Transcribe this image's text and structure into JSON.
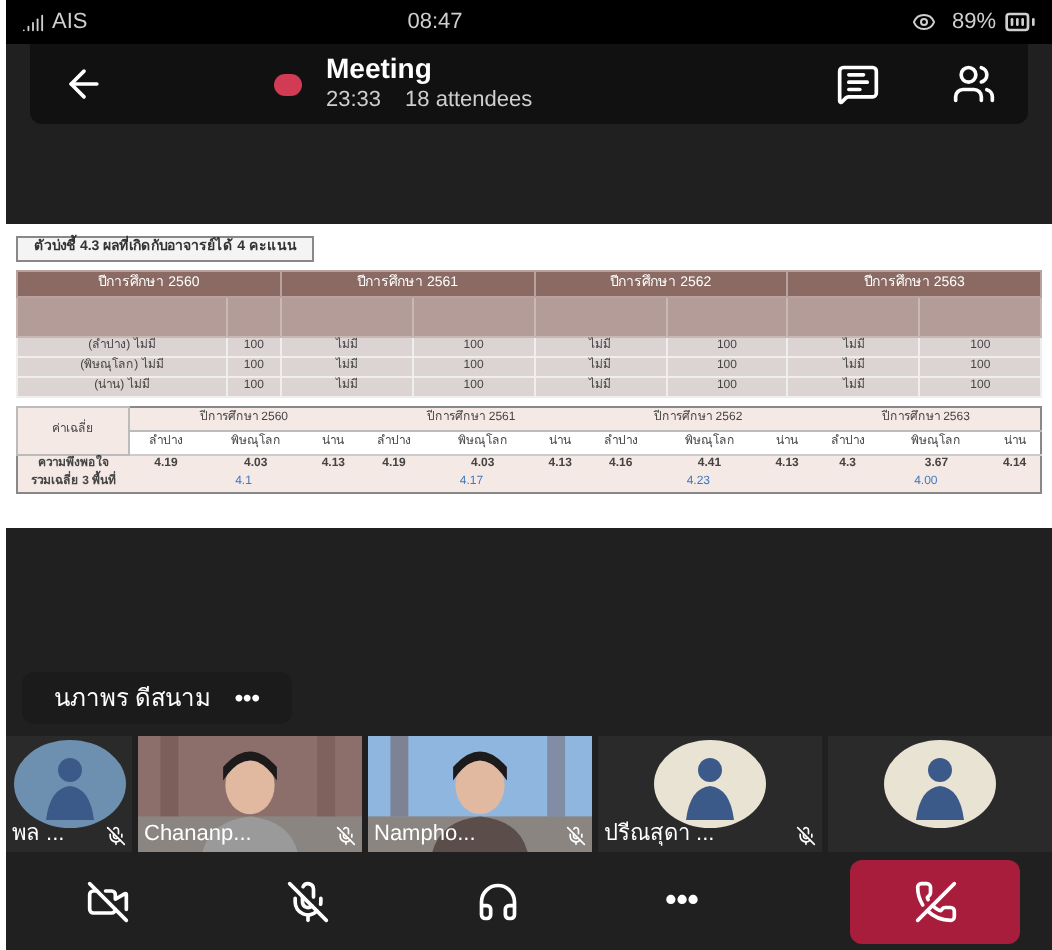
{
  "status_bar": {
    "carrier": "AIS",
    "time": "08:47",
    "battery": "89%"
  },
  "meeting": {
    "title": "Meeting",
    "duration": "23:33",
    "attendees": "18 attendees",
    "recording": true
  },
  "shared_screen": {
    "caption": "ตัวบ่งชี้ 4.3 ผลที่เกิดกับอาจารย์ได้ 4 คะแนน",
    "table_1": {
      "years": [
        "ปีการศึกษา 2560",
        "ปีการศึกษา 2561",
        "ปีการศึกษา 2562",
        "ปีการศึกษา 2563"
      ],
      "rows": [
        [
          "(ลำปาง) ไม่มี",
          "100",
          "ไม่มี",
          "100",
          "ไม่มี",
          "100",
          "ไม่มี",
          "100"
        ],
        [
          "(พิษณุโลก) ไม่มี",
          "100",
          "ไม่มี",
          "100",
          "ไม่มี",
          "100",
          "ไม่มี",
          "100"
        ],
        [
          "(น่าน) ไม่มี",
          "100",
          "ไม่มี",
          "100",
          "ไม่มี",
          "100",
          "ไม่มี",
          "100"
        ]
      ]
    },
    "table_2": {
      "corner": "ค่าเฉลี่ย",
      "years": [
        "ปีการศึกษา 2560",
        "ปีการศึกษา 2561",
        "ปีการศึกษา 2562",
        "ปีการศึกษา 2563"
      ],
      "campuses": [
        "ลำปาง",
        "พิษณุโลก",
        "น่าน",
        "ลำปาง",
        "พิษณุโลก",
        "น่าน",
        "ลำปาง",
        "พิษณุโลก",
        "น่าน",
        "ลำปาง",
        "พิษณุโลก",
        "น่าน"
      ],
      "rows": [
        {
          "label": "ความพึงพอใจ",
          "values": [
            "4.19",
            "4.03",
            "4.13",
            "4.19",
            "4.03",
            "4.13",
            "4.16",
            "4.41",
            "4.13",
            "4.3",
            "3.67",
            "4.14"
          ]
        },
        {
          "label": "รวมเฉลี่ย 3 พื้นที่",
          "averages": [
            "4.1",
            "4.17",
            "4.23",
            "4.00"
          ]
        }
      ]
    }
  },
  "presenter": {
    "name": "นภาพร ดีสนาม",
    "more": "•••"
  },
  "participants": [
    {
      "kind": "avatar",
      "name": "พล ...",
      "muted": true
    },
    {
      "kind": "video",
      "name": "Chananp...",
      "muted": true
    },
    {
      "kind": "video",
      "name": "Nampho...",
      "muted": true
    },
    {
      "kind": "avatar",
      "name": "ปรีณสุดา ...",
      "muted": true
    },
    {
      "kind": "avatar",
      "muted": false
    }
  ],
  "controls": {
    "camera_off": true,
    "mic_muted": true,
    "more": "•••"
  }
}
